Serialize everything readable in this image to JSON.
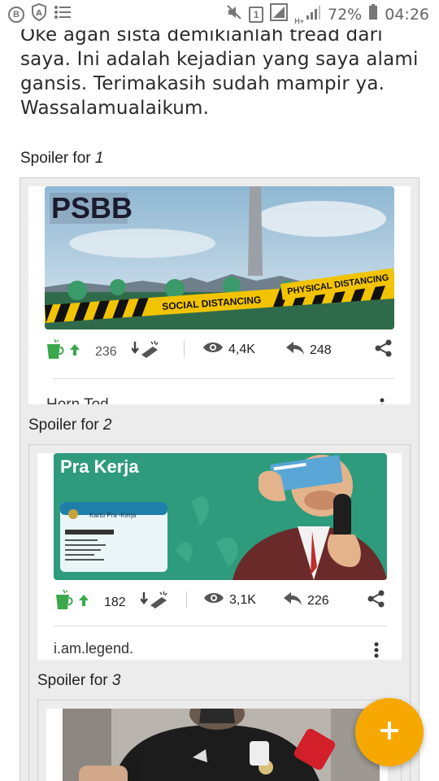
{
  "status_bar": {
    "battery_percent": "72%",
    "time": "04:26",
    "sim_slot": "1",
    "network_type": "H+",
    "icons": [
      "b-icon",
      "a-shield-icon",
      "list-icon",
      "mute-icon",
      "sim-icon",
      "signal-icon",
      "battery-icon"
    ]
  },
  "article": {
    "text": "Oke agan sista demikianlah tread dari saya. Ini adalah kejadian yang saya alami gansis. Terimakasih sudah mampir ya. Wassalamualaikum."
  },
  "spoilers": [
    {
      "label_prefix": "Spoiler for ",
      "label_num": "1",
      "banner_text": "PSBB",
      "tape_text_1": "SOCIAL DISTANCING",
      "tape_text_2": "PHYSICAL DISTANCING",
      "cendol": "236",
      "views": "4,4K",
      "replies": "248",
      "author_partial": "Horn Tod"
    },
    {
      "label_prefix": "Spoiler for ",
      "label_num": "2",
      "banner_text": "Pra Kerja",
      "card_text": "Kartu Pra -Kerja",
      "cendol": "182",
      "views": "3,1K",
      "replies": "226",
      "author": "i.am.legend."
    },
    {
      "label_prefix": "Spoiler for ",
      "label_num": "3"
    }
  ],
  "fab": {
    "icon": "plus-icon",
    "label": "+"
  },
  "colors": {
    "accent": "#f7a800",
    "cendol_green": "#3aa84a"
  }
}
